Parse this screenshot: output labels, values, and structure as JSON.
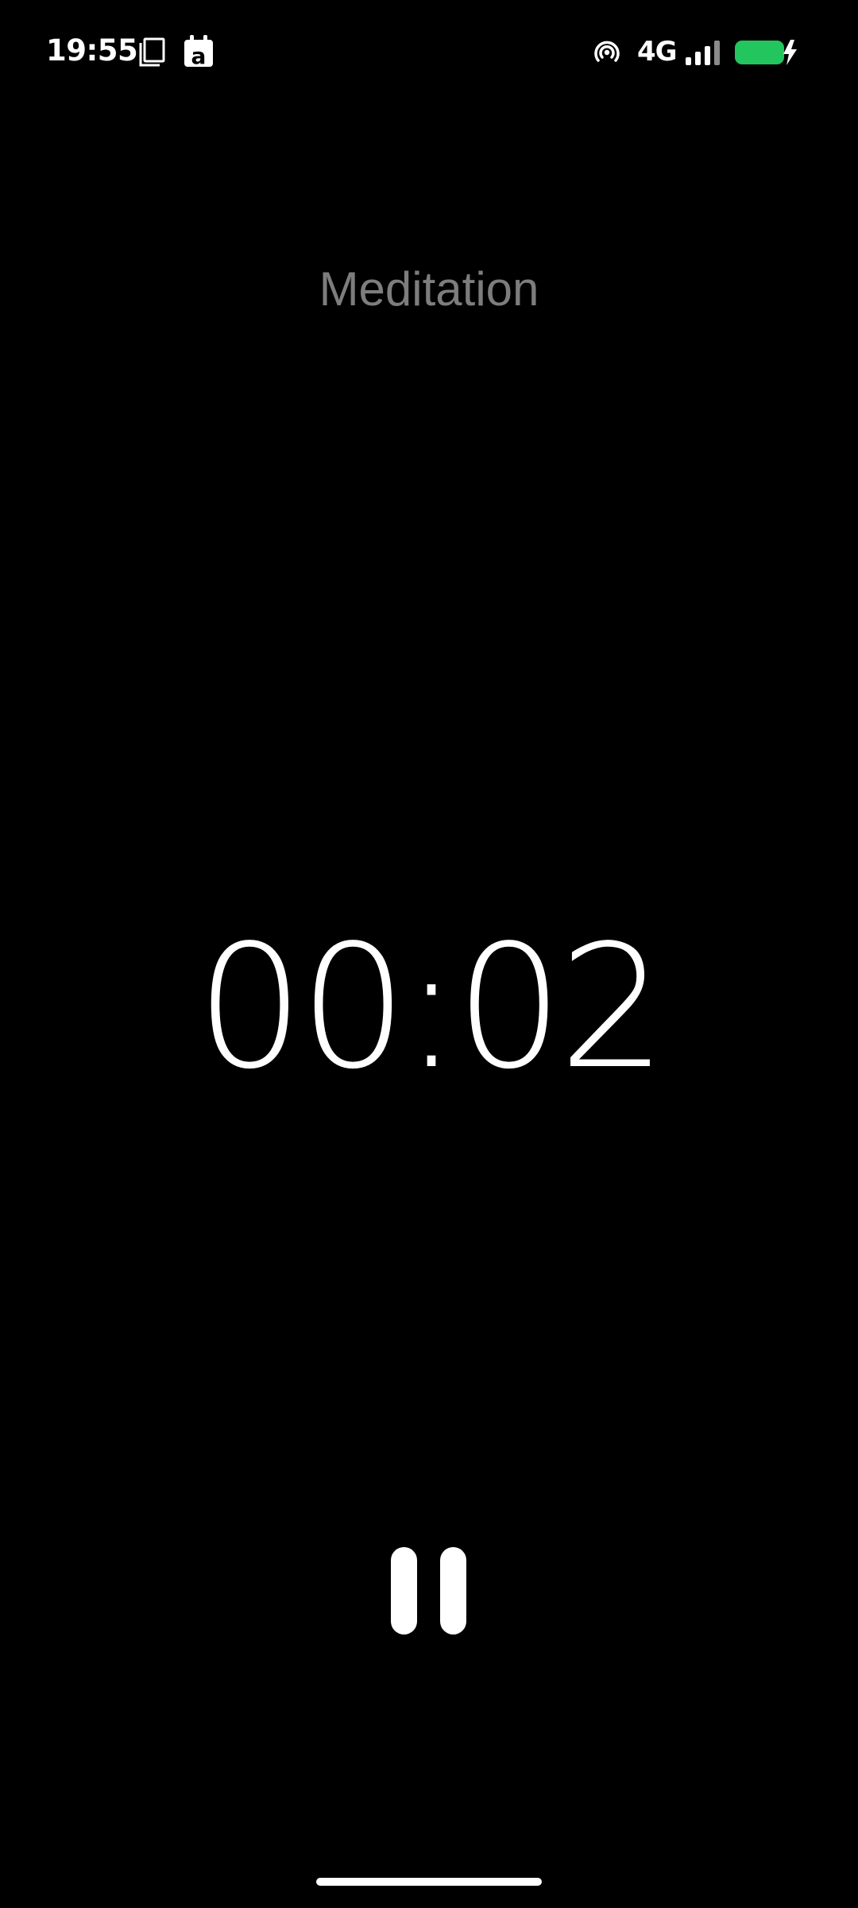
{
  "status_bar": {
    "time": "19:55",
    "network_type": "4G",
    "icons": [
      "screenshot-icon",
      "app-a-icon",
      "hotspot-icon",
      "signal-icon",
      "battery-charging-icon"
    ],
    "battery_color": "#22c55e"
  },
  "session": {
    "title": "Meditation"
  },
  "timer": {
    "elapsed": "00:02"
  },
  "controls": {
    "pause_icon": "pause-icon"
  },
  "colors": {
    "background": "#000000",
    "title": "#7d7d7d",
    "foreground": "#ffffff"
  }
}
